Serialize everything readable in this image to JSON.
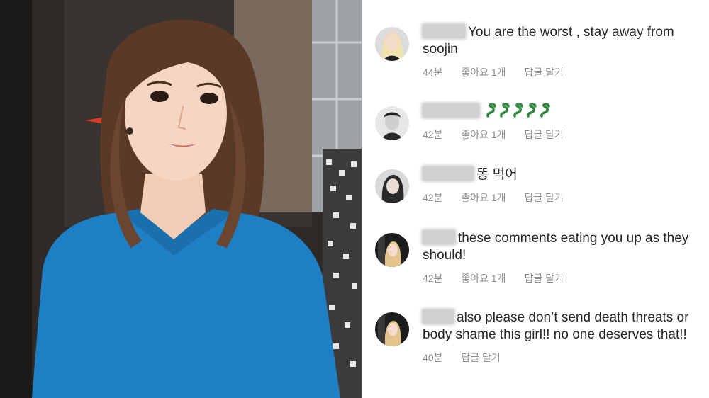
{
  "comments": [
    {
      "author": "(name blurred)",
      "text": "You are the worst , stay away from soojin",
      "time": "44분",
      "likes": "좋아요 1개",
      "reply": "답글 달기"
    },
    {
      "author": "(name blurred)",
      "text": "",
      "emoji": [
        "snake-emoji",
        "snake-emoji",
        "snake-emoji",
        "snake-emoji",
        "snake-emoji"
      ],
      "time": "42분",
      "likes": "좋아요 1개",
      "reply": "답글 달기"
    },
    {
      "author": "(name blurred)",
      "text": "똥 먹어",
      "time": "42분",
      "likes": "좋아요 1개",
      "reply": "답글 달기"
    },
    {
      "author": "(name blurred)",
      "text": "these comments eating you up as they should!",
      "time": "42분",
      "likes": "좋아요 1개",
      "reply": "답글 달기"
    },
    {
      "author": "(name blurred)",
      "text": "also please don’t send death threats or body shame this girl!! no one deserves that!!",
      "time": "40분",
      "reply": "답글 달기"
    }
  ],
  "colors": {
    "comment_text": "#262626",
    "meta_text": "#8e8e8e",
    "sweater": "#1f7fc4"
  }
}
